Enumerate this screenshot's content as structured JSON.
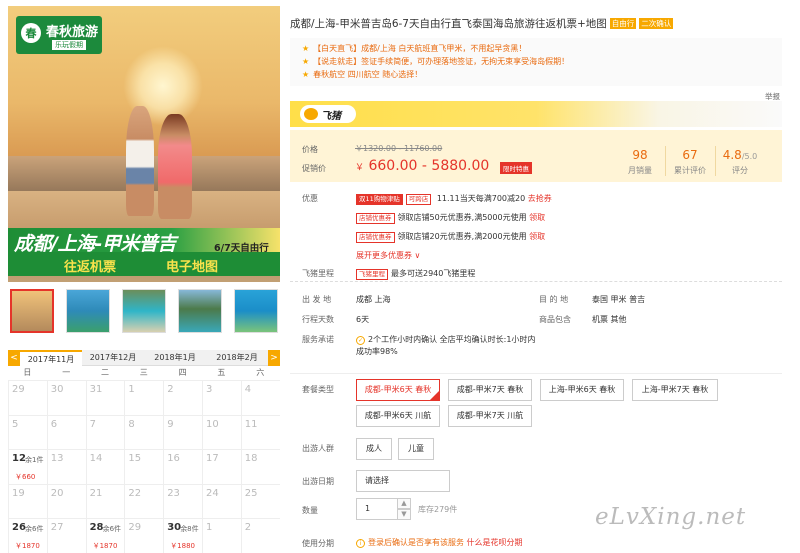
{
  "logo": {
    "brand": "春秋旅游",
    "sub": "乐玩假期",
    "badge": "春"
  },
  "banner": {
    "title": "成都/上海-甲米普吉",
    "sub": "6/7天自由行",
    "t2": "往返机票",
    "t3": "电子地图"
  },
  "thumbnails": [
    "thumb-1",
    "thumb-2",
    "thumb-3",
    "thumb-4",
    "thumb-5"
  ],
  "calendar": {
    "tabs": [
      "2017年11月",
      "2017年12月",
      "2018年1月",
      "2018年2月"
    ],
    "prev": "<",
    "next": ">",
    "weekdays": [
      "日",
      "一",
      "二",
      "三",
      "四",
      "五",
      "六"
    ],
    "rows": [
      [
        {
          "d": "29"
        },
        {
          "d": "30"
        },
        {
          "d": "31"
        },
        {
          "d": "1"
        },
        {
          "d": "2"
        },
        {
          "d": "3"
        },
        {
          "d": "4"
        }
      ],
      [
        {
          "d": "5"
        },
        {
          "d": "6"
        },
        {
          "d": "7"
        },
        {
          "d": "8"
        },
        {
          "d": "9"
        },
        {
          "d": "10"
        },
        {
          "d": "11"
        }
      ],
      [
        {
          "d": "12",
          "on": true,
          "rest": "余1件",
          "price": "￥660"
        },
        {
          "d": "13"
        },
        {
          "d": "14"
        },
        {
          "d": "15"
        },
        {
          "d": "16"
        },
        {
          "d": "17"
        },
        {
          "d": "18"
        }
      ],
      [
        {
          "d": "19"
        },
        {
          "d": "20"
        },
        {
          "d": "21"
        },
        {
          "d": "22"
        },
        {
          "d": "23"
        },
        {
          "d": "24"
        },
        {
          "d": "25"
        }
      ],
      [
        {
          "d": "26",
          "on": true,
          "rest": "余6件",
          "price": "￥1870"
        },
        {
          "d": "27"
        },
        {
          "d": "28",
          "on": true,
          "rest": "余6件",
          "price": "￥1870"
        },
        {
          "d": "29"
        },
        {
          "d": "30",
          "on": true,
          "rest": "余8件",
          "price": "￥1880"
        },
        {
          "d": "1"
        },
        {
          "d": "2"
        }
      ]
    ]
  },
  "product": {
    "title": "成都/上海-甲米普吉岛6-7天自由行直飞泰国海岛旅游往返机票+地图",
    "tags": [
      "自由行",
      "二次确认"
    ],
    "highlights": [
      "【白天直飞】成都/上海 白天航班直飞甲米，不用起早贪黑！",
      "【说走就走】签证手续简便，可办理落地签证，无拘无束享受海岛假期！",
      "春秋航空 四川航空 随心选择！"
    ],
    "star": "★",
    "report": "举报"
  },
  "fliggy": {
    "name": "飞猪"
  },
  "price": {
    "orig_label": "价格",
    "orig": "￥1320.00 - 11760.00",
    "cur_label": "促销价",
    "cur_sym": "￥",
    "cur": "660.00 - 5880.00",
    "limited": "限时特惠",
    "stats": [
      {
        "n": "98",
        "l": "月销量"
      },
      {
        "n": "67",
        "l": "累计评价"
      },
      {
        "n": "4.8",
        "unit": "/5.0",
        "l": "评分"
      }
    ]
  },
  "promos": {
    "label": "优惠",
    "rows": [
      {
        "tag": "双11购物津贴",
        "tag2": "可跨店",
        "text": "11.11当天每满700减20",
        "link": "去抢券"
      },
      {
        "tag": "店铺优惠券",
        "text": "领取店铺50元优惠券,满5000元使用",
        "link": "领取"
      },
      {
        "tag": "店铺优惠券",
        "text": "领取店铺20元优惠券,满2000元使用",
        "link": "领取"
      }
    ],
    "more": "展开更多优惠券 ∨",
    "mileage_label": "飞猪里程",
    "mileage_tag": "飞猪里程",
    "mileage_text": "最多可送2940飞猪里程"
  },
  "info": {
    "dep_label": "出 发 地",
    "dep": "成都  上海",
    "dest_label": "目 的 地",
    "dest": "泰国  甲米  普吉",
    "days_label": "行程天数",
    "days": "6天",
    "inc_label": "商品包含",
    "inc": "机票  其他",
    "svc_label": "服务承诺",
    "svc": "2个工作小时内确认 全店平均确认时长:1小时内 成功率98%"
  },
  "options": {
    "type_label": "套餐类型",
    "types": [
      "成都-甲米6天 春秋",
      "成都-甲米7天 春秋",
      "上海-甲米6天 春秋",
      "上海-甲米7天 春秋",
      "成都-甲米6天 川航",
      "成都-甲米7天 川航"
    ],
    "people_label": "出游人群",
    "people": [
      "成人",
      "儿童"
    ],
    "date_label": "出游日期",
    "date_ph": "请选择",
    "qty_label": "数量",
    "qty": "1",
    "stock": "库存279件",
    "inst_label": "使用分期",
    "inst_text": "登录后确认是否享有该服务",
    "inst_link": "什么是花呗分期"
  },
  "watermark": "eLvXing.net",
  "colors": {
    "accent": "#e5342a",
    "fliggy": "#ffdf49",
    "brand": "#1c8a3c",
    "orange": "#e96b10"
  }
}
